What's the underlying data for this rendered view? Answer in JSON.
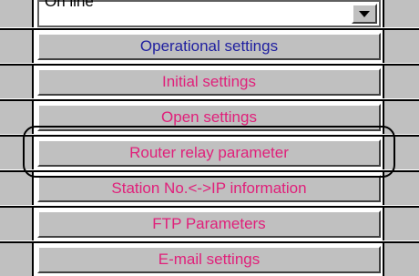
{
  "combo": {
    "value": "On line"
  },
  "buttons": [
    {
      "label": "Operational settings",
      "color": "#2020a0"
    },
    {
      "label": "Initial settings",
      "color": "#e0207a"
    },
    {
      "label": "Open settings",
      "color": "#e0207a"
    },
    {
      "label": "Router relay parameter",
      "color": "#e0207a"
    },
    {
      "label": "Station No.<->IP information",
      "color": "#e0207a"
    },
    {
      "label": "FTP Parameters",
      "color": "#e0207a"
    },
    {
      "label": "E-mail settings",
      "color": "#e0207a"
    }
  ],
  "highlight_target": "Router relay parameter",
  "icons": {
    "combo_arrow": "chevron-down-icon"
  }
}
